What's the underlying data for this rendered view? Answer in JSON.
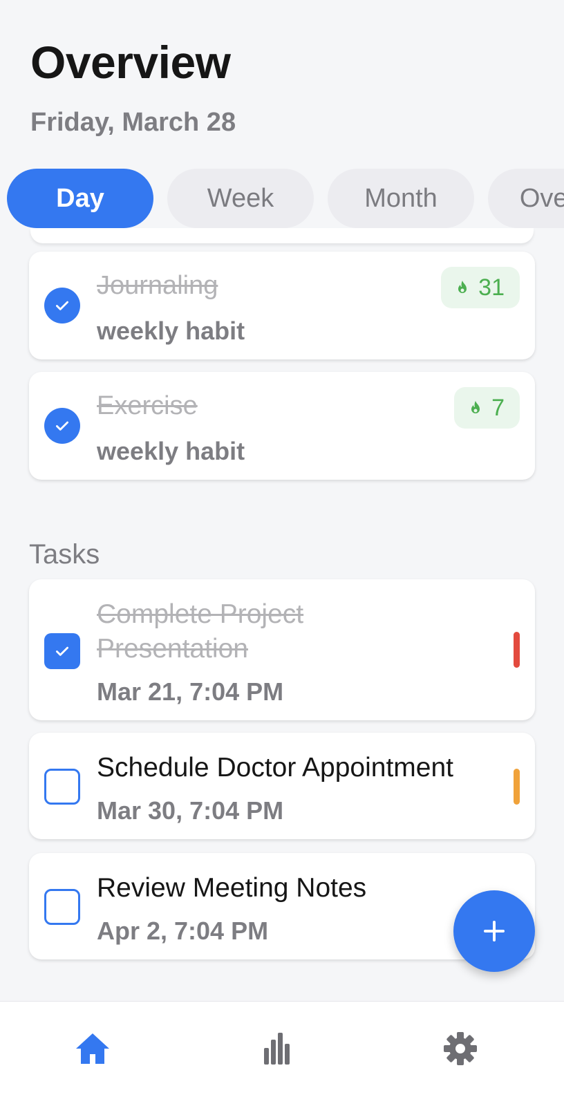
{
  "header": {
    "title": "Overview",
    "date": "Friday, March 28"
  },
  "tabs": [
    {
      "label": "Day",
      "active": true
    },
    {
      "label": "Week",
      "active": false
    },
    {
      "label": "Month",
      "active": false
    },
    {
      "label": "Overall",
      "active": false
    }
  ],
  "habits": [
    {
      "name": "Journaling",
      "frequency": "weekly habit",
      "streak": "31",
      "completed": true,
      "icon": "flame-icon"
    },
    {
      "name": "Exercise",
      "frequency": "weekly habit",
      "streak": "7",
      "completed": true,
      "icon": "flame-icon"
    }
  ],
  "tasks_section": {
    "label": "Tasks"
  },
  "tasks": [
    {
      "title": "Complete Project Presentation",
      "title_line1": "Complete Project",
      "title_line2": "Presentation",
      "date": "Mar 21, 7:04 PM",
      "completed": true,
      "priority_color": "#e34a3e"
    },
    {
      "title": "Schedule Doctor Appointment",
      "date": "Mar 30, 7:04 PM",
      "completed": false,
      "priority_color": "#f0a23a"
    },
    {
      "title": "Review Meeting Notes",
      "date": "Apr 2, 7:04 PM",
      "completed": false,
      "priority_color": ""
    }
  ],
  "fab": {
    "icon": "plus-icon"
  },
  "bottom_nav": [
    {
      "name": "home",
      "icon": "home-icon",
      "active": true
    },
    {
      "name": "stats",
      "icon": "bar-chart-icon",
      "active": false
    },
    {
      "name": "settings",
      "icon": "gear-icon",
      "active": false
    }
  ],
  "colors": {
    "accent": "#3478f0",
    "streak_green": "#4caf50",
    "streak_bg": "#eaf6ec",
    "muted_text": "#7d7d82"
  }
}
